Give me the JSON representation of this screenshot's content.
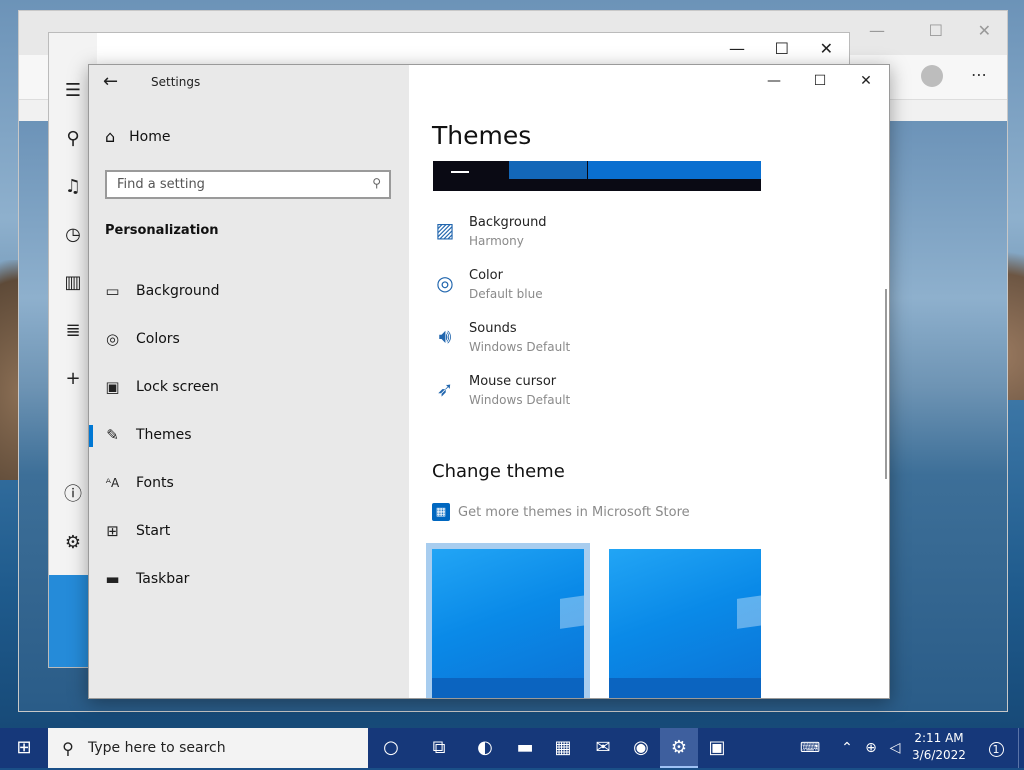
{
  "colors": {
    "accent": "#0078d4",
    "taskbar": "#16387a",
    "nav_bg": "#e9e9e9"
  },
  "settings": {
    "app_title": "Settings",
    "home_label": "Home",
    "search_placeholder": "Find a setting",
    "section_label": "Personalization",
    "nav_items": [
      {
        "label": "Background",
        "icon": "image-icon"
      },
      {
        "label": "Colors",
        "icon": "palette-icon"
      },
      {
        "label": "Lock screen",
        "icon": "lock-screen-icon"
      },
      {
        "label": "Themes",
        "icon": "themes-icon",
        "active": true
      },
      {
        "label": "Fonts",
        "icon": "fonts-icon"
      },
      {
        "label": "Start",
        "icon": "start-icon"
      },
      {
        "label": "Taskbar",
        "icon": "taskbar-icon"
      }
    ],
    "page_title": "Themes",
    "properties": [
      {
        "name": "Background",
        "value": "Harmony",
        "icon": "image-icon"
      },
      {
        "name": "Color",
        "value": "Default blue",
        "icon": "palette-icon"
      },
      {
        "name": "Sounds",
        "value": "Windows Default",
        "icon": "speaker-icon"
      },
      {
        "name": "Mouse cursor",
        "value": "Windows Default",
        "icon": "mouse-cursor-icon"
      }
    ],
    "change_theme_heading": "Change theme",
    "store_link": "Get more themes in Microsoft Store"
  },
  "taskbar": {
    "search_placeholder": "Type here to search",
    "time": "2:11 AM",
    "date": "3/6/2022",
    "notification_count": "1"
  }
}
